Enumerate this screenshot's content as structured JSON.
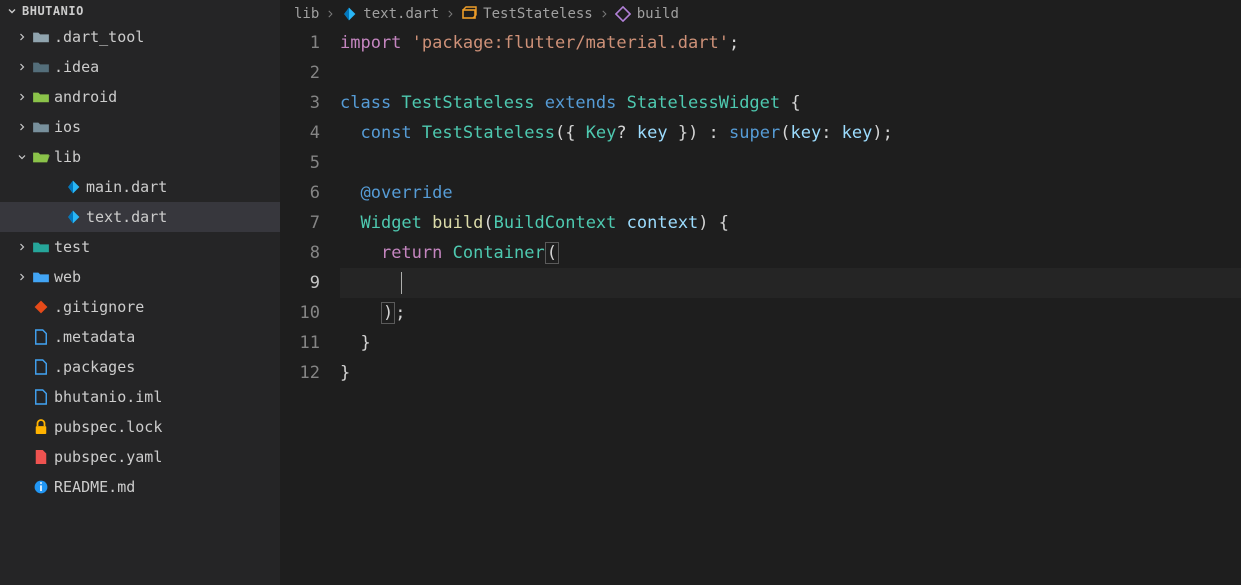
{
  "sidebar": {
    "title": "BHUTANIO",
    "items": [
      {
        "name": ".dart_tool",
        "kind": "folder",
        "depth": 1,
        "expanded": false,
        "icon": "folder-gray"
      },
      {
        "name": ".idea",
        "kind": "folder",
        "depth": 1,
        "expanded": false,
        "icon": "folder-dark"
      },
      {
        "name": "android",
        "kind": "folder",
        "depth": 1,
        "expanded": false,
        "icon": "folder-android"
      },
      {
        "name": "ios",
        "kind": "folder",
        "depth": 1,
        "expanded": false,
        "icon": "folder-ios"
      },
      {
        "name": "lib",
        "kind": "folder",
        "depth": 1,
        "expanded": true,
        "icon": "folder-lib"
      },
      {
        "name": "main.dart",
        "kind": "file",
        "depth": 2,
        "icon": "dart"
      },
      {
        "name": "text.dart",
        "kind": "file",
        "depth": 2,
        "icon": "dart",
        "active": true
      },
      {
        "name": "test",
        "kind": "folder",
        "depth": 1,
        "expanded": false,
        "icon": "folder-test"
      },
      {
        "name": "web",
        "kind": "folder",
        "depth": 1,
        "expanded": false,
        "icon": "folder-web"
      },
      {
        "name": ".gitignore",
        "kind": "file",
        "depth": 1,
        "icon": "git"
      },
      {
        "name": ".metadata",
        "kind": "file",
        "depth": 1,
        "icon": "file-blue"
      },
      {
        "name": ".packages",
        "kind": "file",
        "depth": 1,
        "icon": "file-blue"
      },
      {
        "name": "bhutanio.iml",
        "kind": "file",
        "depth": 1,
        "icon": "file-blue"
      },
      {
        "name": "pubspec.lock",
        "kind": "file",
        "depth": 1,
        "icon": "lock"
      },
      {
        "name": "pubspec.yaml",
        "kind": "file",
        "depth": 1,
        "icon": "yaml"
      },
      {
        "name": "README.md",
        "kind": "file",
        "depth": 1,
        "icon": "info"
      }
    ]
  },
  "breadcrumb": {
    "items": [
      {
        "label": "lib",
        "icon": null
      },
      {
        "label": "text.dart",
        "icon": "dart"
      },
      {
        "label": "TestStateless",
        "icon": "class"
      },
      {
        "label": "build",
        "icon": "method"
      }
    ]
  },
  "editor": {
    "currentLine": 9,
    "lines": [
      {
        "n": 1,
        "segments": [
          {
            "t": "import ",
            "c": "tok-kw"
          },
          {
            "t": "'package:flutter/material.dart'",
            "c": "tok-str"
          },
          {
            "t": ";",
            "c": "tok-plain"
          }
        ]
      },
      {
        "n": 2,
        "segments": []
      },
      {
        "n": 3,
        "segments": [
          {
            "t": "class ",
            "c": "tok-const"
          },
          {
            "t": "TestStateless ",
            "c": "tok-type"
          },
          {
            "t": "extends ",
            "c": "tok-const"
          },
          {
            "t": "StatelessWidget ",
            "c": "tok-type"
          },
          {
            "t": "{",
            "c": "tok-plain"
          }
        ]
      },
      {
        "n": 4,
        "segments": [
          {
            "t": "  ",
            "c": "tok-plain"
          },
          {
            "t": "const ",
            "c": "tok-const"
          },
          {
            "t": "TestStateless",
            "c": "tok-type"
          },
          {
            "t": "({ ",
            "c": "tok-plain"
          },
          {
            "t": "Key",
            "c": "tok-type"
          },
          {
            "t": "? ",
            "c": "tok-plain"
          },
          {
            "t": "key ",
            "c": "tok-var"
          },
          {
            "t": "}) : ",
            "c": "tok-plain"
          },
          {
            "t": "super",
            "c": "tok-const"
          },
          {
            "t": "(",
            "c": "tok-plain"
          },
          {
            "t": "key",
            "c": "tok-var"
          },
          {
            "t": ": ",
            "c": "tok-plain"
          },
          {
            "t": "key",
            "c": "tok-var"
          },
          {
            "t": ");",
            "c": "tok-plain"
          }
        ]
      },
      {
        "n": 5,
        "segments": []
      },
      {
        "n": 6,
        "segments": [
          {
            "t": "  ",
            "c": "tok-plain"
          },
          {
            "t": "@override",
            "c": "tok-anno"
          }
        ]
      },
      {
        "n": 7,
        "segments": [
          {
            "t": "  ",
            "c": "tok-plain"
          },
          {
            "t": "Widget ",
            "c": "tok-type"
          },
          {
            "t": "build",
            "c": "tok-fn"
          },
          {
            "t": "(",
            "c": "tok-plain"
          },
          {
            "t": "BuildContext ",
            "c": "tok-type"
          },
          {
            "t": "context",
            "c": "tok-var"
          },
          {
            "t": ") {",
            "c": "tok-plain"
          }
        ]
      },
      {
        "n": 8,
        "segments": [
          {
            "t": "    ",
            "c": "tok-plain"
          },
          {
            "t": "return ",
            "c": "tok-kw"
          },
          {
            "t": "Container",
            "c": "tok-type"
          },
          {
            "t": "(",
            "c": "bracket-box"
          }
        ]
      },
      {
        "n": 9,
        "segments": [
          {
            "t": "      ",
            "c": "tok-plain"
          }
        ],
        "cursor": true
      },
      {
        "n": 10,
        "segments": [
          {
            "t": "    ",
            "c": "tok-plain"
          },
          {
            "t": ")",
            "c": "bracket-box"
          },
          {
            "t": ";",
            "c": "tok-plain"
          }
        ]
      },
      {
        "n": 11,
        "segments": [
          {
            "t": "  }",
            "c": "tok-plain"
          }
        ]
      },
      {
        "n": 12,
        "segments": [
          {
            "t": "}",
            "c": "tok-plain"
          }
        ]
      }
    ]
  },
  "icons": {
    "folder-gray": "#90a4ae",
    "folder-dark": "#546e7a",
    "folder-android": "#8bc34a",
    "folder-ios": "#78909c",
    "folder-lib": "#8bc34a",
    "folder-test": "#26a69a",
    "folder-web": "#42a5f5",
    "dart": "#29b6f6",
    "git": "#e64a19",
    "file-blue": "#42a5f5",
    "lock": "#ffb300",
    "yaml": "#ef5350",
    "info": "#2196f3",
    "class": "#ee9d28",
    "method": "#b180d7"
  }
}
